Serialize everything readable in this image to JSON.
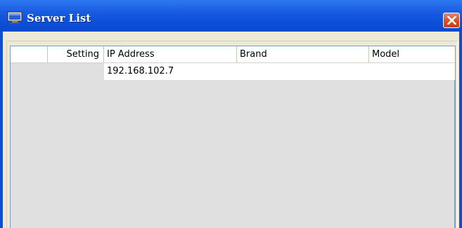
{
  "window": {
    "title": "Server List"
  },
  "icons": {
    "app": "monitor-icon",
    "close": "close-icon"
  },
  "colors": {
    "titlebar": "#0a49cc",
    "close_button": "#d8532a",
    "client_background": "#ece9d8",
    "list_background": "#e0e0e0"
  },
  "server_list": {
    "columns": [
      "",
      "Setting",
      "IP Address",
      "Brand",
      "Model"
    ],
    "rows": [
      {
        "select": "",
        "setting": "",
        "ip_address": "192.168.102.7",
        "brand": "",
        "model": ""
      }
    ]
  }
}
